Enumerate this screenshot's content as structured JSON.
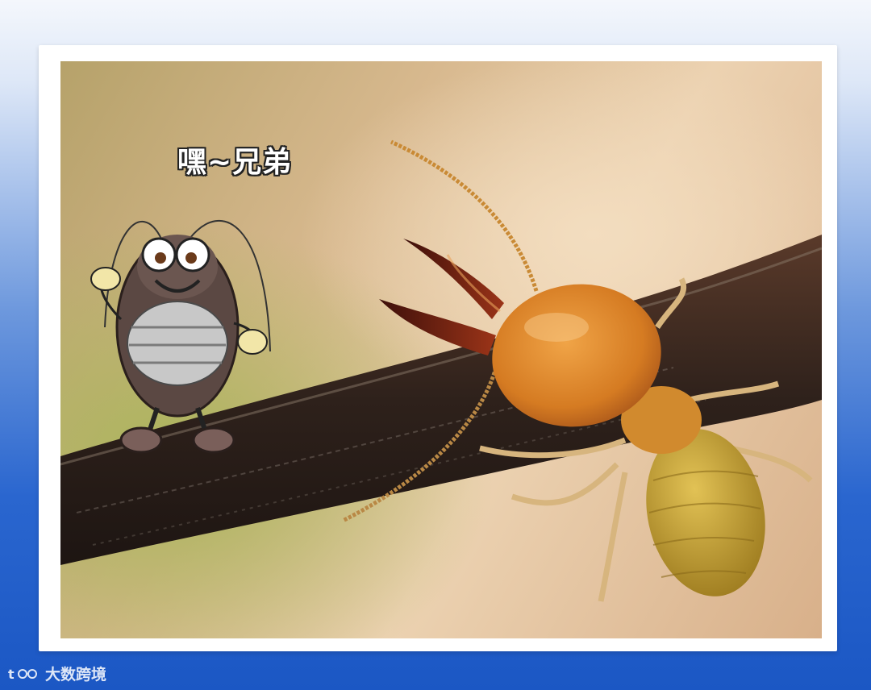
{
  "caption": "嘿~兄弟",
  "watermark": {
    "logo": "logo-icon",
    "text": "大数跨境"
  },
  "illustration": {
    "cartoon": "cockroach-cartoon",
    "photo_subject": "termite-soldier-on-twig"
  },
  "colors": {
    "frame": "#ffffff",
    "background_top": "#f4f7fc",
    "background_bottom": "#1b57c4",
    "termite_head": "#d9852a",
    "mandible": "#7a1f12"
  }
}
